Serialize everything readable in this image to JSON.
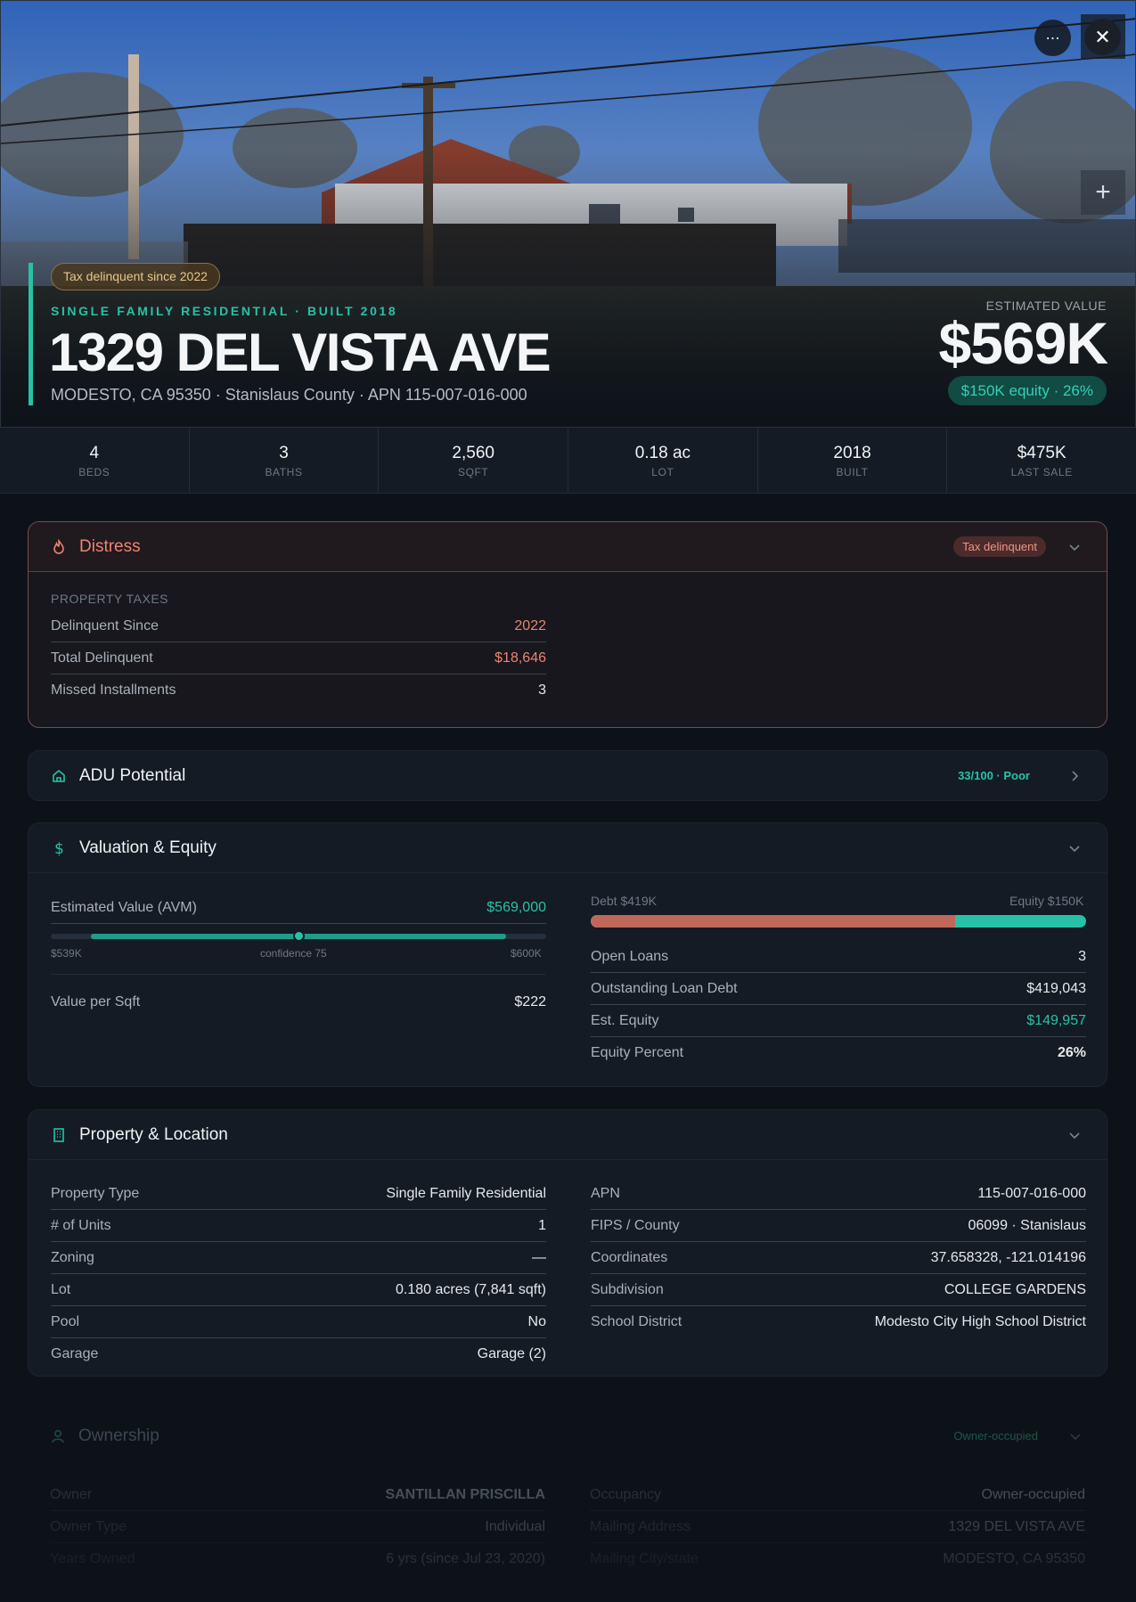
{
  "hero": {
    "badge": "Tax delinquent since 2022",
    "kicker": "SINGLE FAMILY RESIDENTIAL · BUILT 2018",
    "address": "1329 DEL VISTA AVE",
    "subaddress": "MODESTO, CA 95350 · Stanislaus County · APN 115-007-016-000",
    "estimated_label": "ESTIMATED VALUE",
    "estimated_value": "$569K",
    "equity_pill": "$150K equity · 26%",
    "more_icon": "⋯",
    "close_icon": "✕",
    "zoom_icon": "+"
  },
  "stats": [
    {
      "value": "4",
      "label": "BEDS"
    },
    {
      "value": "3",
      "label": "BATHS"
    },
    {
      "value": "2,560",
      "label": "SQFT"
    },
    {
      "value": "0.18 ac",
      "label": "LOT"
    },
    {
      "value": "2018",
      "label": "BUILT"
    },
    {
      "value": "$475K",
      "label": "LAST SALE"
    }
  ],
  "distress": {
    "title": "Distress",
    "badge": "Tax delinquent",
    "section": "PROPERTY TAXES",
    "rows": [
      {
        "k": "Delinquent Since",
        "v": "2022"
      },
      {
        "k": "Total Delinquent",
        "v": "$18,646"
      },
      {
        "k": "Missed Installments",
        "v": "3"
      }
    ]
  },
  "adu": {
    "title": "ADU Potential",
    "score": "33/100 · Poor"
  },
  "valuation": {
    "title": "Valuation & Equity",
    "avm_label": "Estimated Value (AVM)",
    "avm_value": "$569,000",
    "avm_low": "$539K",
    "avm_mid": "confidence 75",
    "avm_high": "$600K",
    "avm_confidence": 75,
    "per_sqft_label": "Value per Sqft",
    "per_sqft_value": "$222",
    "debt_label": "Debt $419K",
    "equity_label": "Equity $150K",
    "debt_fraction": 0.736,
    "rows": [
      {
        "k": "Open Loans",
        "v": "3"
      },
      {
        "k": "Outstanding Loan Debt",
        "v": "$419,043"
      },
      {
        "k": "Est. Equity",
        "v": "$149,957"
      },
      {
        "k": "Equity Percent",
        "v": "26%"
      }
    ]
  },
  "property": {
    "title": "Property & Location",
    "left": [
      {
        "k": "Property Type",
        "v": "Single Family Residential"
      },
      {
        "k": "# of Units",
        "v": "1"
      },
      {
        "k": "Zoning",
        "v": "—"
      },
      {
        "k": "Lot",
        "v": "0.180 acres (7,841 sqft)"
      },
      {
        "k": "Pool",
        "v": "No"
      },
      {
        "k": "Garage",
        "v": "Garage (2)"
      }
    ],
    "right": [
      {
        "k": "APN",
        "v": "115-007-016-000"
      },
      {
        "k": "FIPS / County",
        "v": "06099 · Stanislaus"
      },
      {
        "k": "Coordinates",
        "v": "37.658328, -121.014196"
      },
      {
        "k": "Subdivision",
        "v": "COLLEGE GARDENS"
      },
      {
        "k": "School District",
        "v": "Modesto City High School District"
      }
    ]
  },
  "ownership": {
    "title": "Ownership",
    "badge": "Owner-occupied",
    "left": [
      {
        "k": "Owner",
        "v": "SANTILLAN PRISCILLA"
      },
      {
        "k": "Owner Type",
        "v": "Individual"
      },
      {
        "k": "Years Owned",
        "v": "6 yrs (since Jul 23, 2020)"
      }
    ],
    "right": [
      {
        "k": "Occupancy",
        "v": "Owner-occupied"
      },
      {
        "k": "Mailing Address",
        "v": "1329 DEL VISTA AVE"
      },
      {
        "k": "Mailing City/state",
        "v": "MODESTO, CA 95350"
      }
    ]
  },
  "colors": {
    "accent": "#27c2a6",
    "distress": "#ef8271",
    "debt": "#c0675b",
    "background": "#0d1219"
  }
}
